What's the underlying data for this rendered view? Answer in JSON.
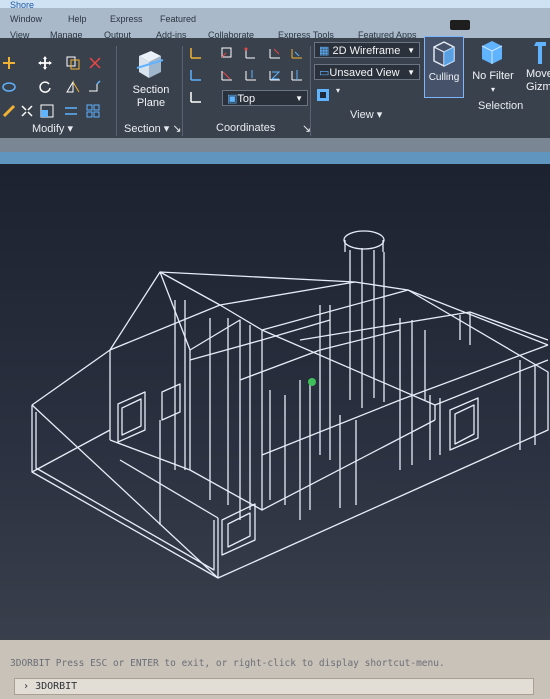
{
  "window": {
    "title": "Shore"
  },
  "tabs_row1": [
    "Window",
    "Help",
    "Express",
    "Featured"
  ],
  "tabs_row2": [
    "View",
    "Manage",
    "Output",
    "Add-ins",
    "Collaborate",
    "Express Tools",
    "Featured Apps"
  ],
  "ribbon": {
    "modify": {
      "title": "Modify"
    },
    "section": {
      "button": "Section\nPlane",
      "title": "Section"
    },
    "coordinates": {
      "ucs_combo": "Top",
      "title": "Coordinates"
    },
    "view": {
      "visual_style": "2D Wireframe",
      "named_view": "Unsaved View",
      "title": "View"
    },
    "selection": {
      "culling": "Culling",
      "no_filter": "No Filter",
      "move_gizmo": "Move\nGizmo",
      "title": "Selection"
    }
  },
  "command": {
    "message": "3DORBIT Press ESC or ENTER to exit, or right-click to display shortcut-menu.",
    "prompt_symbol": "›",
    "input": "3DORBIT"
  }
}
